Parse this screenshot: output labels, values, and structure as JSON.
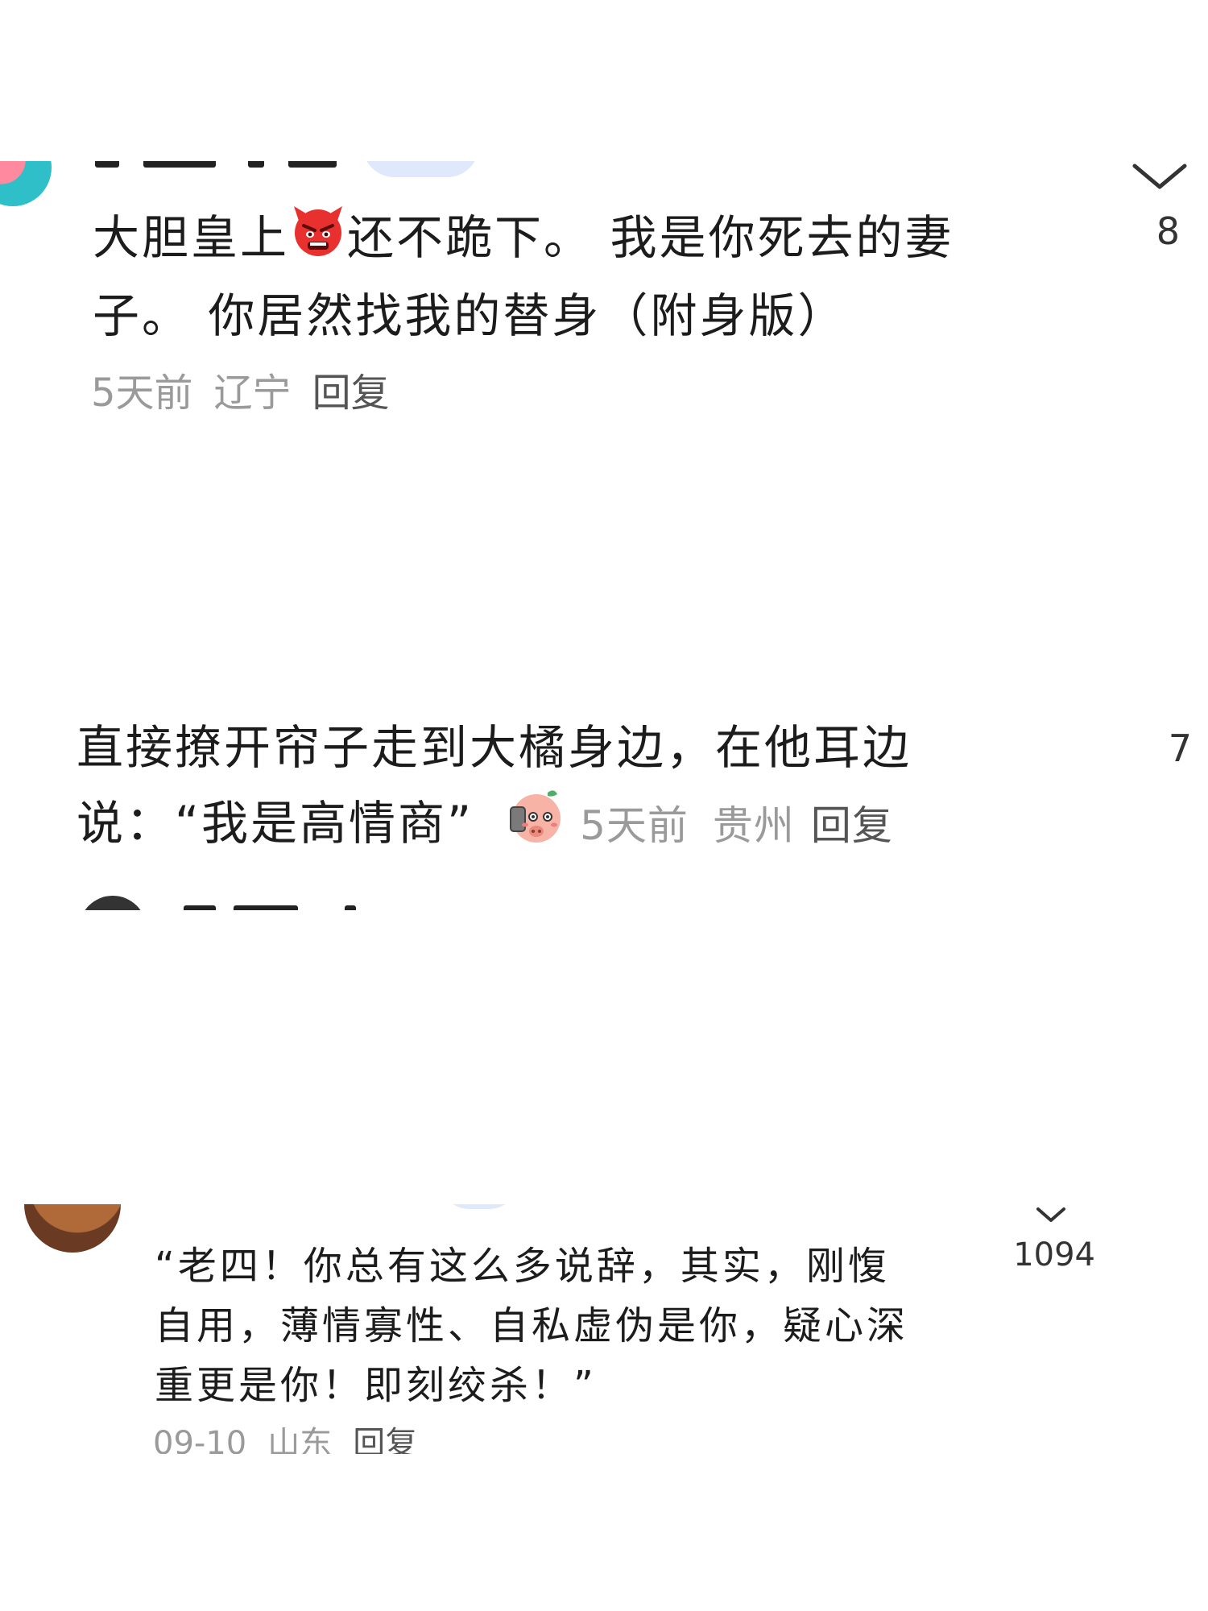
{
  "comments": [
    {
      "text_before_emoji": "大胆皇上",
      "emoji": "angry-devil-emoji",
      "text_after_emoji": "还不跪下。 我是你死去的妻子。 你居然找我的替身（附身版）",
      "time": "5天前",
      "location": "辽宁",
      "reply_label": "回复",
      "likes": "8"
    },
    {
      "text": "直接撩开帘子走到大橘身边，在他耳边说：“我是高情商”",
      "emoji": "pig-phone-emoji",
      "time": "5天前",
      "location": "贵州",
      "reply_label": "回复",
      "likes": "7"
    },
    {
      "text": "“老四！你总有这么多说辞，其实，刚愎自用，薄情寡性、自私虚伪是你，疑心深重更是你！即刻绞杀！”",
      "time": "09-10",
      "location": "山东",
      "reply_label": "回复",
      "likes": "1094"
    }
  ],
  "icons": {
    "expand": "chevron-down-icon"
  },
  "colors": {
    "text": "#1c1c1c",
    "meta": "#9a9a9a",
    "reply": "#555555",
    "tag_bg": "#dfe9fb"
  }
}
